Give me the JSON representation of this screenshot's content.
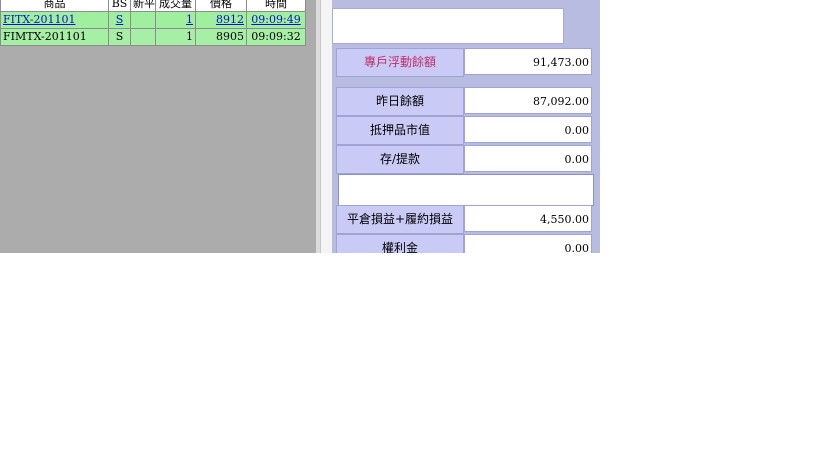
{
  "trades": {
    "headers": {
      "product": "商品",
      "bs": "BS",
      "open_close": "新平",
      "volume": "成交量",
      "price": "價格",
      "time": "時間"
    },
    "rows": [
      {
        "product": "FITX-201101",
        "bs": "S",
        "open_close": "",
        "volume": "1",
        "price": "8912",
        "time": "09:09:49"
      },
      {
        "product": "FIMTX-201101",
        "bs": "S",
        "open_close": "",
        "volume": "1",
        "price": "8905",
        "time": "09:09:32"
      }
    ]
  },
  "balance": {
    "floating_balance": {
      "label": "專戶浮動餘額",
      "value": "91,473.00"
    },
    "rows": [
      {
        "label": "昨日餘額",
        "value": "87,092.00"
      },
      {
        "label": "抵押品市值",
        "value": "0.00"
      },
      {
        "label": "存/提款",
        "value": "0.00"
      },
      {
        "label": "平倉損益+履約損益",
        "value": "4,550.00"
      },
      {
        "label": "權利金",
        "value": "0.00"
      }
    ]
  }
}
